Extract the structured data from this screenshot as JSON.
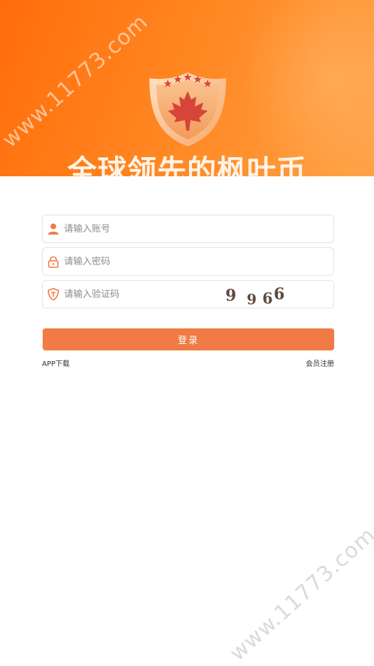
{
  "hero": {
    "title": "全球领先的枫叶币",
    "watermark_top": "www.11773.com"
  },
  "form": {
    "account_placeholder": "请输入账号",
    "password_placeholder": "请输入密码",
    "captcha_placeholder": "请输入验证码",
    "captcha_text": [
      "9",
      "9",
      "6",
      "6"
    ]
  },
  "actions": {
    "login_label": "登录",
    "app_download_label": "APP下载",
    "register_label": "会员注册"
  },
  "watermark_bottom": "www.11773.com",
  "icons": [
    "user-icon",
    "lock-icon",
    "shield-t-icon",
    "maple-leaf-icon"
  ],
  "colors": {
    "accent": "#f07b44",
    "hero_start": "#ff6d0a",
    "hero_end": "#ffa246",
    "icon": "#f07b44"
  }
}
